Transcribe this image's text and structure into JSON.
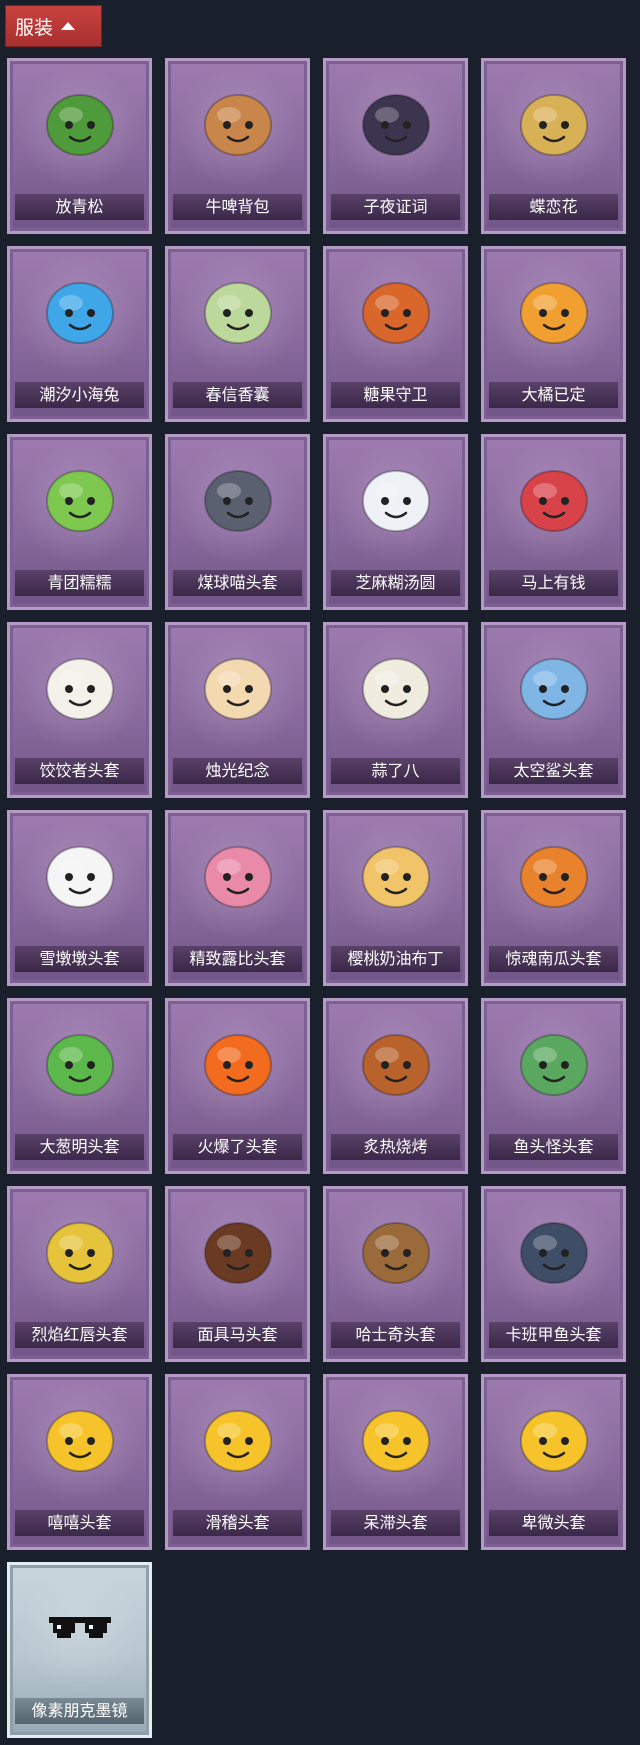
{
  "header": {
    "title": "服装"
  },
  "items": [
    {
      "label": "放青松",
      "icon": "pine-bonsai-icon",
      "color": "#4f9a3a",
      "frame": "purple"
    },
    {
      "label": "牛啤背包",
      "icon": "cow-beer-barrel-icon",
      "color": "#c9864a",
      "frame": "purple"
    },
    {
      "label": "子夜证词",
      "icon": "plague-doctor-bird-icon",
      "color": "#3b3550",
      "frame": "purple"
    },
    {
      "label": "蝶恋花",
      "icon": "floral-bell-wreath-icon",
      "color": "#d8b056",
      "frame": "purple"
    },
    {
      "label": "潮汐小海兔",
      "icon": "sea-bunny-icon",
      "color": "#3fa6e8",
      "frame": "purple"
    },
    {
      "label": "春信香囊",
      "icon": "sachet-pouch-icon",
      "color": "#bcd89a",
      "frame": "purple"
    },
    {
      "label": "糖果守卫",
      "icon": "candy-scarecrow-icon",
      "color": "#d9662a",
      "frame": "purple"
    },
    {
      "label": "大橘已定",
      "icon": "orange-slice-icon",
      "color": "#f0a030",
      "frame": "purple"
    },
    {
      "label": "青团糯糯",
      "icon": "green-rice-ball-icon",
      "color": "#7ec850",
      "frame": "purple"
    },
    {
      "label": "煤球喵头套",
      "icon": "gray-cat-head-icon",
      "color": "#5b6070",
      "frame": "purple"
    },
    {
      "label": "芝麻糊汤圆",
      "icon": "rice-dumpling-icon",
      "color": "#eef2f6",
      "frame": "purple"
    },
    {
      "label": "马上有钱",
      "icon": "red-horse-head-icon",
      "color": "#d8434a",
      "frame": "purple"
    },
    {
      "label": "饺饺者头套",
      "icon": "dumpling-head-icon",
      "color": "#f4f1ea",
      "frame": "purple"
    },
    {
      "label": "烛光纪念",
      "icon": "candle-head-icon",
      "color": "#f3d9b0",
      "frame": "purple"
    },
    {
      "label": "蒜了八",
      "icon": "garlic-head-icon",
      "color": "#f1ece0",
      "frame": "purple"
    },
    {
      "label": "太空鲨头套",
      "icon": "space-shark-head-icon",
      "color": "#7fb6e6",
      "frame": "purple"
    },
    {
      "label": "雪墩墩头套",
      "icon": "snowman-reindeer-head-icon",
      "color": "#f5f5f5",
      "frame": "purple"
    },
    {
      "label": "精致露比头套",
      "icon": "pink-beaver-head-icon",
      "color": "#e98aa8",
      "frame": "purple"
    },
    {
      "label": "樱桃奶油布丁",
      "icon": "cherry-pudding-icon",
      "color": "#f2c46a",
      "frame": "purple"
    },
    {
      "label": "惊魂南瓜头套",
      "icon": "pumpkin-head-icon",
      "color": "#e9822c",
      "frame": "purple"
    },
    {
      "label": "大葱明头套",
      "icon": "scallion-head-icon",
      "color": "#5cb84a",
      "frame": "purple"
    },
    {
      "label": "火爆了头套",
      "icon": "fire-head-icon",
      "color": "#f26b1f",
      "frame": "purple"
    },
    {
      "label": "炙热烧烤",
      "icon": "bbq-meat-head-icon",
      "color": "#b9622c",
      "frame": "purple"
    },
    {
      "label": "鱼头怪头套",
      "icon": "fish-monster-head-icon",
      "color": "#5aa860",
      "frame": "purple"
    },
    {
      "label": "烈焰红唇头套",
      "icon": "yellow-mask-sunglasses-icon",
      "color": "#e5c33a",
      "frame": "purple"
    },
    {
      "label": "面具马头套",
      "icon": "horse-mask-head-icon",
      "color": "#6b3a22",
      "frame": "purple"
    },
    {
      "label": "哈士奇头套",
      "icon": "husky-sunglasses-head-icon",
      "color": "#9a6a3a",
      "frame": "purple"
    },
    {
      "label": "卡班甲鱼头套",
      "icon": "catfish-head-icon",
      "color": "#3f4d66",
      "frame": "purple"
    },
    {
      "label": "嘻嘻头套",
      "icon": "grinning-emoji-head-icon",
      "color": "#f6c42a",
      "frame": "purple"
    },
    {
      "label": "滑稽头套",
      "icon": "funny-emoji-head-icon",
      "color": "#f6c42a",
      "frame": "purple"
    },
    {
      "label": "呆滞头套",
      "icon": "dazed-emoji-head-icon",
      "color": "#f6c42a",
      "frame": "purple"
    },
    {
      "label": "卑微头套",
      "icon": "humble-emoji-head-icon",
      "color": "#f6c42a",
      "frame": "purple"
    },
    {
      "label": "像素朋克墨镜",
      "icon": "pixel-sunglasses-icon",
      "color": "#111111",
      "frame": "silver"
    }
  ]
}
